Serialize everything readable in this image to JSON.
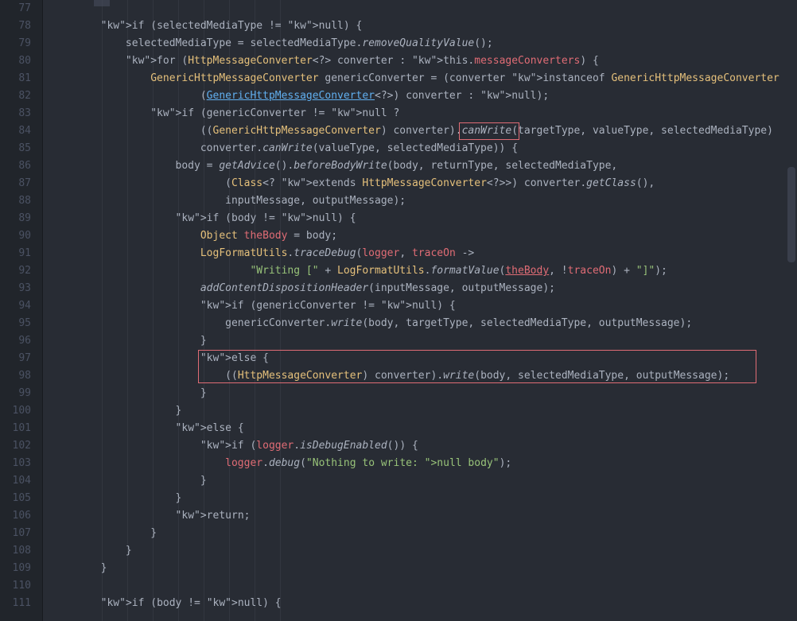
{
  "chart_data": null,
  "editor": {
    "startLine": 77,
    "lineCount": 35,
    "highlights": [
      {
        "lineIndex": 7,
        "text": ".canWrite"
      },
      {
        "lineIndex": 21,
        "text": "((HttpMessageConverter) converter).write(body, selectedMediaType, outputMessage);"
      }
    ],
    "lines": [
      {
        "n": 77,
        "i": 2,
        "t": ""
      },
      {
        "n": 78,
        "i": 2,
        "t": "if (selectedMediaType != null) {"
      },
      {
        "n": 79,
        "i": 3,
        "t": "selectedMediaType = selectedMediaType.removeQualityValue();"
      },
      {
        "n": 80,
        "i": 3,
        "t": "for (HttpMessageConverter<?> converter : this.messageConverters) {"
      },
      {
        "n": 81,
        "i": 4,
        "t": "GenericHttpMessageConverter genericConverter = (converter instanceof GenericHttpMessageConverter ?"
      },
      {
        "n": 82,
        "i": 6,
        "t": "(GenericHttpMessageConverter<?>) converter : null);"
      },
      {
        "n": 83,
        "i": 4,
        "t": "if (genericConverter != null ?"
      },
      {
        "n": 84,
        "i": 6,
        "t": "((GenericHttpMessageConverter) converter).canWrite(targetType, valueType, selectedMediaType)"
      },
      {
        "n": 85,
        "i": 6,
        "t": "converter.canWrite(valueType, selectedMediaType)) {"
      },
      {
        "n": 86,
        "i": 5,
        "t": "body = getAdvice().beforeBodyWrite(body, returnType, selectedMediaType,"
      },
      {
        "n": 87,
        "i": 7,
        "t": "(Class<? extends HttpMessageConverter<?>>) converter.getClass(),"
      },
      {
        "n": 88,
        "i": 7,
        "t": "inputMessage, outputMessage);"
      },
      {
        "n": 89,
        "i": 5,
        "t": "if (body != null) {"
      },
      {
        "n": 90,
        "i": 6,
        "t": "Object theBody = body;"
      },
      {
        "n": 91,
        "i": 6,
        "t": "LogFormatUtils.traceDebug(logger, traceOn ->"
      },
      {
        "n": 92,
        "i": 8,
        "t": "\"Writing [\" + LogFormatUtils.formatValue(theBody, !traceOn) + \"]\");"
      },
      {
        "n": 93,
        "i": 6,
        "t": "addContentDispositionHeader(inputMessage, outputMessage);"
      },
      {
        "n": 94,
        "i": 6,
        "t": "if (genericConverter != null) {"
      },
      {
        "n": 95,
        "i": 7,
        "t": "genericConverter.write(body, targetType, selectedMediaType, outputMessage);"
      },
      {
        "n": 96,
        "i": 6,
        "t": "}"
      },
      {
        "n": 97,
        "i": 6,
        "t": "else {"
      },
      {
        "n": 98,
        "i": 7,
        "t": "((HttpMessageConverter) converter).write(body, selectedMediaType, outputMessage);"
      },
      {
        "n": 99,
        "i": 6,
        "t": "}"
      },
      {
        "n": 100,
        "i": 5,
        "t": "}"
      },
      {
        "n": 101,
        "i": 5,
        "t": "else {"
      },
      {
        "n": 102,
        "i": 6,
        "t": "if (logger.isDebugEnabled()) {"
      },
      {
        "n": 103,
        "i": 7,
        "t": "logger.debug(\"Nothing to write: null body\");"
      },
      {
        "n": 104,
        "i": 6,
        "t": "}"
      },
      {
        "n": 105,
        "i": 5,
        "t": "}"
      },
      {
        "n": 106,
        "i": 5,
        "t": "return;"
      },
      {
        "n": 107,
        "i": 4,
        "t": "}"
      },
      {
        "n": 108,
        "i": 3,
        "t": "}"
      },
      {
        "n": 109,
        "i": 2,
        "t": "}"
      },
      {
        "n": 110,
        "i": 2,
        "t": ""
      },
      {
        "n": 111,
        "i": 2,
        "t": "if (body != null) {"
      }
    ]
  }
}
